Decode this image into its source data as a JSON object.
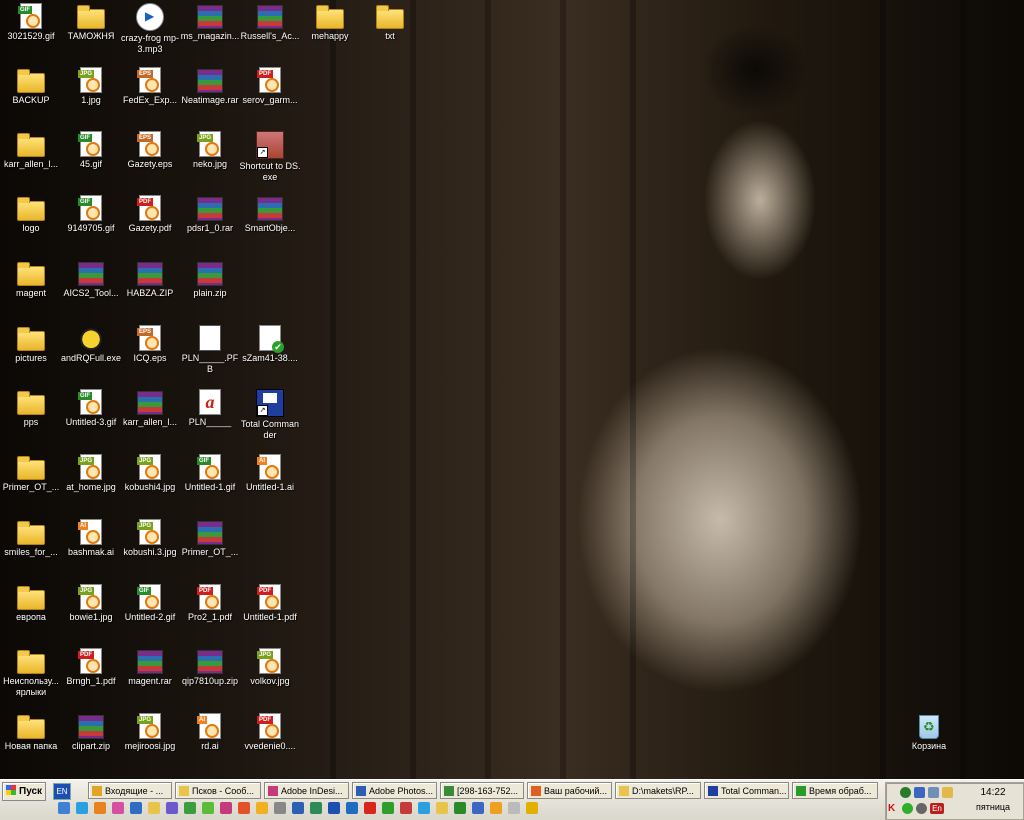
{
  "desktop": {
    "icons": [
      {
        "label": "3021529.gif",
        "type": "gif"
      },
      {
        "label": "ТАМОЖНЯ",
        "type": "folder"
      },
      {
        "label": "crazy-frog mp-3.mp3",
        "type": "mp3"
      },
      {
        "label": "ms_magazin...",
        "type": "rar"
      },
      {
        "label": "Russell's_Ac...",
        "type": "rar"
      },
      {
        "label": "mehappy",
        "type": "folder"
      },
      {
        "label": "txt",
        "type": "folder"
      },
      {
        "label": "BACKUP",
        "type": "folder"
      },
      {
        "label": "1.jpg",
        "type": "jpg"
      },
      {
        "label": "FedEx_Exp...",
        "type": "eps"
      },
      {
        "label": "Neatimage.rar",
        "type": "rar"
      },
      {
        "label": "serov_garm...",
        "type": "pdf"
      },
      {
        "label": "karr_allen_l...",
        "type": "folder"
      },
      {
        "label": "45.gif",
        "type": "gif"
      },
      {
        "label": "Gazety.eps",
        "type": "eps"
      },
      {
        "label": "neko.jpg",
        "type": "jpg"
      },
      {
        "label": "Shortcut to DS.exe",
        "type": "ds"
      },
      {
        "label": "logo",
        "type": "folder"
      },
      {
        "label": "9149705.gif",
        "type": "gif"
      },
      {
        "label": "Gazety.pdf",
        "type": "pdf"
      },
      {
        "label": "pdsr1_0.rar",
        "type": "rar"
      },
      {
        "label": "SmartObje...",
        "type": "rar"
      },
      {
        "label": "magent",
        "type": "folder"
      },
      {
        "label": "AICS2_Tool...",
        "type": "rar"
      },
      {
        "label": "HABZA.ZIP",
        "type": "rar"
      },
      {
        "label": "plain.zip",
        "type": "rar"
      },
      {
        "label": "pictures",
        "type": "folder"
      },
      {
        "label": "andRQFull.exe",
        "type": "bee"
      },
      {
        "label": "ICQ.eps",
        "type": "eps"
      },
      {
        "label": "PLN_____.PFB",
        "type": "pfb"
      },
      {
        "label": "sZam41-38....",
        "type": "check"
      },
      {
        "label": "pps",
        "type": "folder"
      },
      {
        "label": "Untitled-3.gif",
        "type": "gif"
      },
      {
        "label": "karr_allen_l...",
        "type": "rar"
      },
      {
        "label": "PLN_____",
        "type": "font"
      },
      {
        "label": "Total Commander",
        "type": "tc"
      },
      {
        "label": "Primer_OT_...",
        "type": "folder"
      },
      {
        "label": "at_home.jpg",
        "type": "jpg"
      },
      {
        "label": "kobushi4.jpg",
        "type": "jpg"
      },
      {
        "label": "Untitled-1.gif",
        "type": "gif"
      },
      {
        "label": "Untitled-1.ai",
        "type": "ai"
      },
      {
        "label": "smiles_for_...",
        "type": "folder"
      },
      {
        "label": "bashmak.ai",
        "type": "ai"
      },
      {
        "label": "kobushi.3.jpg",
        "type": "jpg"
      },
      {
        "label": "Primer_OT_...",
        "type": "rar"
      },
      {
        "label": "европа",
        "type": "folder"
      },
      {
        "label": "bowie1.jpg",
        "type": "jpg"
      },
      {
        "label": "Untitled-2.gif",
        "type": "gif"
      },
      {
        "label": "Pro2_1.pdf",
        "type": "pdf"
      },
      {
        "label": "Untitled-1.pdf",
        "type": "pdf"
      },
      {
        "label": "Неиспользу... ярлыки",
        "type": "folder"
      },
      {
        "label": "Brngh_1.pdf",
        "type": "pdf"
      },
      {
        "label": "magent.rar",
        "type": "rar"
      },
      {
        "label": "qip7810up.zip",
        "type": "rar"
      },
      {
        "label": "volkov.jpg",
        "type": "jpg"
      },
      {
        "label": "Новая папка",
        "type": "folder"
      },
      {
        "label": "clipart.zip",
        "type": "rar"
      },
      {
        "label": "mejiroosi.jpg",
        "type": "jpg"
      },
      {
        "label": "rd.ai",
        "type": "ai"
      },
      {
        "label": "vvedenie0....",
        "type": "pdf"
      }
    ],
    "recycle_bin": {
      "label": "Корзина"
    }
  },
  "taskbar": {
    "start_label": "Пуск",
    "lang_quick": "EN",
    "tasks": [
      {
        "label": "Входящие - ...",
        "icon": "outlook"
      },
      {
        "label": "Псков - Сооб...",
        "icon": "mail"
      },
      {
        "label": "Adobe InDesi...",
        "icon": "indesign"
      },
      {
        "label": "Adobe Photos...",
        "icon": "photoshop"
      },
      {
        "label": "[298-163-752...",
        "icon": "qip"
      },
      {
        "label": "Ваш рабочий...",
        "icon": "browser"
      },
      {
        "label": "D:\\makets\\RP...",
        "icon": "folder"
      },
      {
        "label": "Total Comman...",
        "icon": "tc"
      },
      {
        "label": "Время обраб...",
        "icon": "app"
      }
    ],
    "tray": {
      "lang": "En",
      "time": "14:22",
      "day": "пятница"
    }
  }
}
